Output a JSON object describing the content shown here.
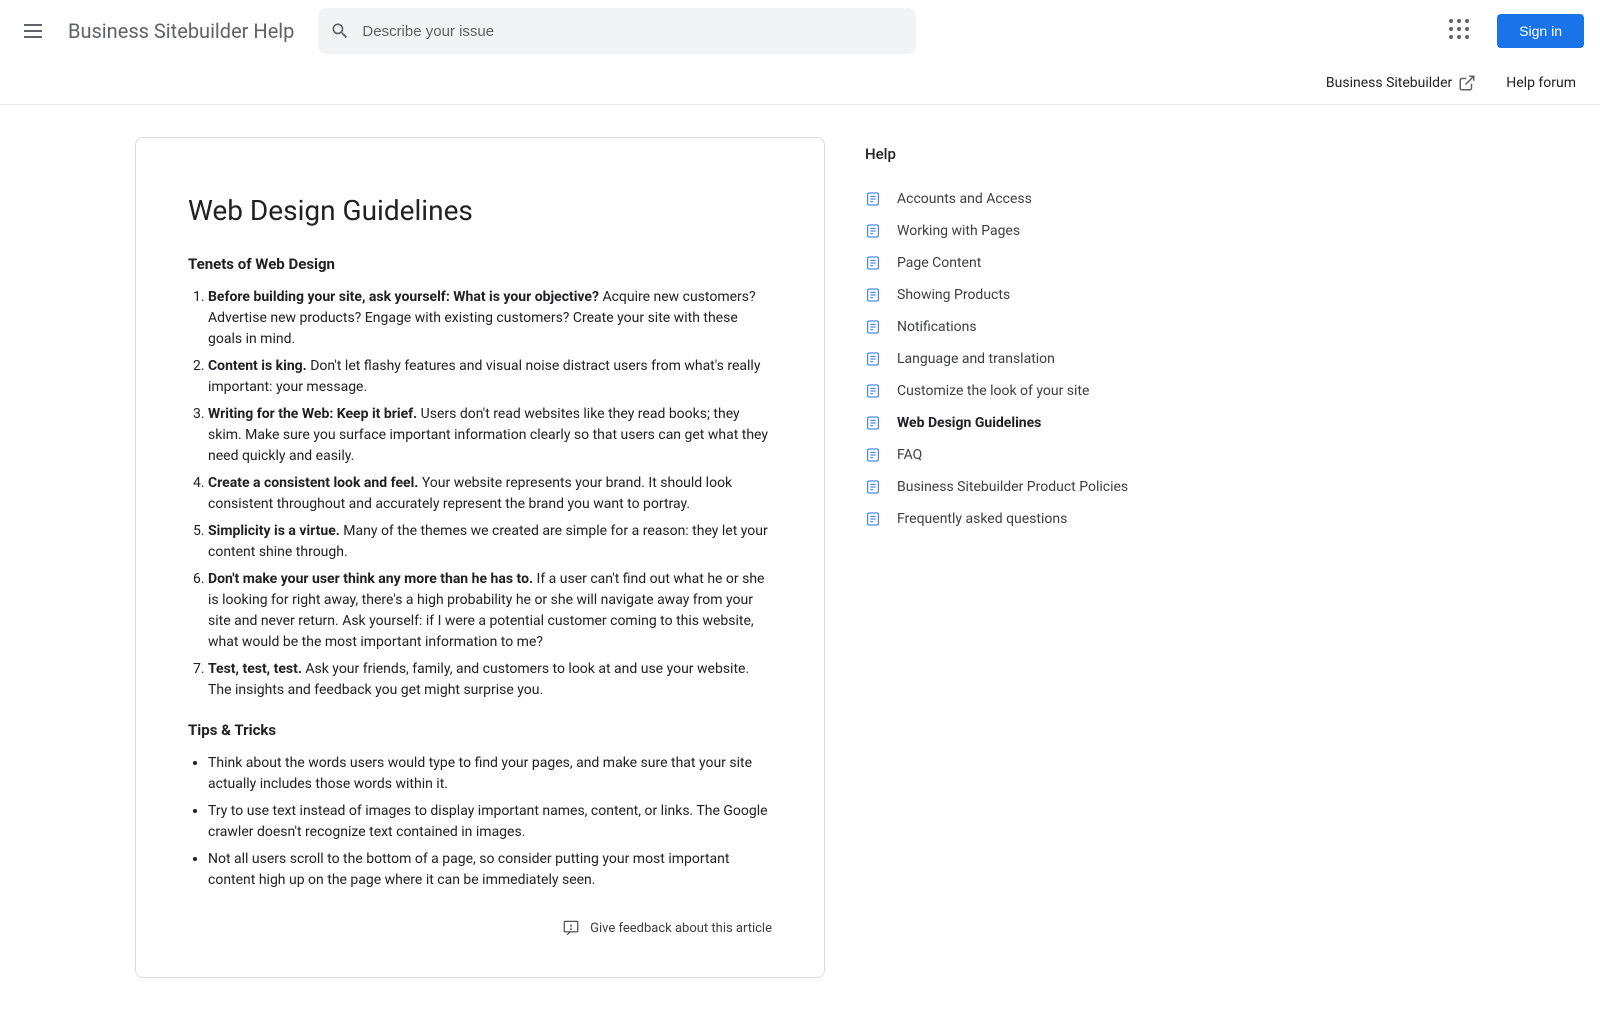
{
  "header": {
    "site_title": "Business Sitebuilder Help",
    "search_placeholder": "Describe your issue",
    "signin_label": "Sign in",
    "product_link": "Business Sitebuilder",
    "forum_link": "Help forum"
  },
  "article": {
    "title": "Web Design Guidelines",
    "section1_heading": "Tenets of Web Design",
    "tenets": [
      {
        "bold": "Before building your site, ask yourself: What is your objective?",
        "rest": " Acquire new customers? Advertise new products? Engage with existing customers? Create your site with these goals in mind."
      },
      {
        "bold": "Content is king.",
        "rest": " Don't let flashy features and visual noise distract users from what's really important: your message."
      },
      {
        "bold": "Writing for the Web: Keep it brief.",
        "rest": " Users don't read websites like they read books; they skim. Make sure you surface important information clearly so that users can get what they need quickly and easily."
      },
      {
        "bold": "Create a consistent look and feel.",
        "rest": " Your website represents your brand. It should look consistent throughout and accurately represent the brand you want to portray."
      },
      {
        "bold": "Simplicity is a virtue.",
        "rest": " Many of the themes we created are simple for a reason: they let your content shine through."
      },
      {
        "bold": "Don't make your user think any more than he has to.",
        "rest": " If a user can't find out what he or she is looking for right away, there's a high probability he or she will navigate away from your site and never return. Ask yourself: if I were a potential customer coming to this website, what would be the most important information to me?"
      },
      {
        "bold": "Test, test, test.",
        "rest": " Ask your friends, family, and customers to look at and use your website. The insights and feedback you get might surprise you."
      }
    ],
    "section2_heading": "Tips & Tricks",
    "tips": [
      "Think about the words users would type to find your pages, and make sure that your site actually includes those words within it.",
      "Try to use text instead of images to display important names, content, or links. The Google crawler doesn't recognize text contained in images.",
      "Not all users scroll to the bottom of a page, so consider putting your most important content high up on the page where it can be immediately seen."
    ],
    "feedback_label": "Give feedback about this article"
  },
  "sidebar": {
    "heading": "Help",
    "items": [
      {
        "label": "Accounts and Access",
        "active": false
      },
      {
        "label": "Working with Pages",
        "active": false
      },
      {
        "label": "Page Content",
        "active": false
      },
      {
        "label": "Showing Products",
        "active": false
      },
      {
        "label": "Notifications",
        "active": false
      },
      {
        "label": "Language and translation",
        "active": false
      },
      {
        "label": "Customize the look of your site",
        "active": false
      },
      {
        "label": "Web Design Guidelines",
        "active": true
      },
      {
        "label": "FAQ",
        "active": false
      },
      {
        "label": "Business Sitebuilder Product Policies",
        "active": false
      },
      {
        "label": "Frequently asked questions",
        "active": false
      }
    ]
  }
}
